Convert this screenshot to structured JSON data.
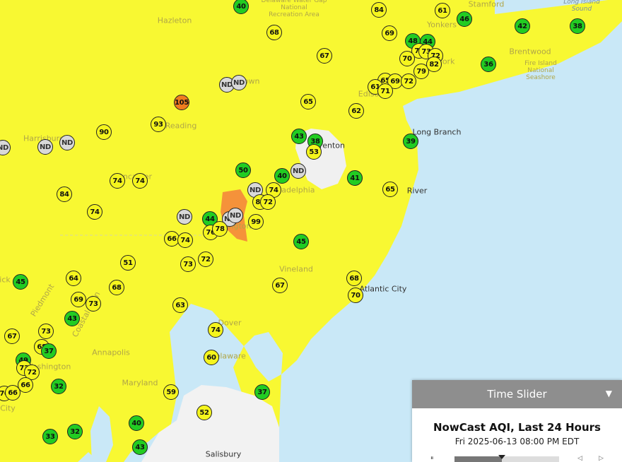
{
  "panel": {
    "header": "Time Slider",
    "toggle": "▼",
    "title": "NowCast AQI, Last 24 Hours",
    "timestamp": "Fri 2025-06-13 08:00 PM EDT",
    "progress": 0.45,
    "pause_icon": "⏸",
    "prev_icon": "◁",
    "next_icon": "▷"
  },
  "colors": {
    "good": "#22cc22",
    "moderate": "#f5f51d",
    "usg": "#f07d1e",
    "no_data": "#d9d9d9",
    "water": "#c9e8f7",
    "moderate_area": "#f8f832",
    "usg_area": "#f5923a"
  },
  "labels": [
    {
      "text": "Hazleton",
      "cls": "faded"
    },
    {
      "text": "Reading",
      "cls": "faded"
    },
    {
      "text": "town",
      "cls": "faded"
    },
    {
      "text": "Harrisburg",
      "cls": "faded"
    },
    {
      "text": "Lancaster",
      "cls": "faded"
    },
    {
      "text": "renton",
      "cls": "city"
    },
    {
      "text": "Long Branch",
      "cls": "city"
    },
    {
      "text": "Philadelphia",
      "cls": "faded"
    },
    {
      "text": "River",
      "cls": "city"
    },
    {
      "text": "ington",
      "cls": "faded"
    },
    {
      "text": "Vineland",
      "cls": "faded"
    },
    {
      "text": "Atlantic City",
      "cls": "city"
    },
    {
      "text": "Dover",
      "cls": "faded"
    },
    {
      "text": "Delaware",
      "cls": "faded"
    },
    {
      "text": "Annapolis",
      "cls": "faded"
    },
    {
      "text": "Washington",
      "cls": "faded"
    },
    {
      "text": "Maryland",
      "cls": "faded"
    },
    {
      "text": "Salisbury",
      "cls": "city"
    },
    {
      "text": "Yonkers",
      "cls": "faded"
    },
    {
      "text": "Stamford",
      "cls": "faded"
    },
    {
      "text": "York",
      "cls": "faded"
    },
    {
      "text": "Edison",
      "cls": "faded"
    },
    {
      "text": "Brentwood",
      "cls": "faded"
    },
    {
      "text": "Fire Island\nNational\nSeashore",
      "cls": "fadedsm"
    },
    {
      "text": "Delaware Water Gap\nNational\nRecreation Area",
      "cls": "fadedsm"
    },
    {
      "text": "Long Island\nSound",
      "cls": "water"
    },
    {
      "text": "ick",
      "cls": "faded"
    },
    {
      "text": "City",
      "cls": "faded"
    },
    {
      "text": "Piedmont",
      "cls": "faded"
    },
    {
      "text": "Coastal Plain",
      "cls": "faded"
    }
  ],
  "markers": [
    {
      "v": "40",
      "c": "good"
    },
    {
      "v": "84",
      "c": "moderate"
    },
    {
      "v": "61",
      "c": "moderate"
    },
    {
      "v": "46",
      "c": "good"
    },
    {
      "v": "42",
      "c": "good"
    },
    {
      "v": "38",
      "c": "good"
    },
    {
      "v": "68",
      "c": "moderate"
    },
    {
      "v": "69",
      "c": "moderate"
    },
    {
      "v": "48",
      "c": "good"
    },
    {
      "v": "44",
      "c": "good"
    },
    {
      "v": "75",
      "c": "moderate"
    },
    {
      "v": "73",
      "c": "moderate"
    },
    {
      "v": "70",
      "c": "moderate"
    },
    {
      "v": "72",
      "c": "moderate"
    },
    {
      "v": "67",
      "c": "moderate"
    },
    {
      "v": "79",
      "c": "moderate"
    },
    {
      "v": "82",
      "c": "moderate"
    },
    {
      "v": "36",
      "c": "good"
    },
    {
      "v": "ND",
      "c": "nd"
    },
    {
      "v": "ND",
      "c": "nd"
    },
    {
      "v": "65",
      "c": "moderate"
    },
    {
      "v": "69",
      "c": "moderate"
    },
    {
      "v": "72",
      "c": "moderate"
    },
    {
      "v": "61",
      "c": "moderate"
    },
    {
      "v": "71",
      "c": "moderate"
    },
    {
      "v": "105",
      "c": "usg"
    },
    {
      "v": "65",
      "c": "moderate"
    },
    {
      "v": "62",
      "c": "moderate"
    },
    {
      "v": "90",
      "c": "moderate"
    },
    {
      "v": "93",
      "c": "moderate"
    },
    {
      "v": "ND",
      "c": "nd"
    },
    {
      "v": "ND",
      "c": "nd"
    },
    {
      "v": "ND",
      "c": "nd"
    },
    {
      "v": "43",
      "c": "good"
    },
    {
      "v": "38",
      "c": "good"
    },
    {
      "v": "53",
      "c": "moderate"
    },
    {
      "v": "39",
      "c": "good"
    },
    {
      "v": "50",
      "c": "good"
    },
    {
      "v": "ND",
      "c": "nd"
    },
    {
      "v": "40",
      "c": "good"
    },
    {
      "v": "41",
      "c": "good"
    },
    {
      "v": "74",
      "c": "moderate"
    },
    {
      "v": "74",
      "c": "moderate"
    },
    {
      "v": "84",
      "c": "moderate"
    },
    {
      "v": "ND",
      "c": "nd"
    },
    {
      "v": "74",
      "c": "moderate"
    },
    {
      "v": "65",
      "c": "moderate"
    },
    {
      "v": "80",
      "c": "moderate"
    },
    {
      "v": "72",
      "c": "moderate"
    },
    {
      "v": "74",
      "c": "moderate"
    },
    {
      "v": "ND",
      "c": "nd"
    },
    {
      "v": "ND",
      "c": "nd"
    },
    {
      "v": "ND",
      "c": "nd"
    },
    {
      "v": "44",
      "c": "good"
    },
    {
      "v": "76",
      "c": "moderate"
    },
    {
      "v": "78",
      "c": "moderate"
    },
    {
      "v": "99",
      "c": "moderate"
    },
    {
      "v": "66",
      "c": "moderate"
    },
    {
      "v": "74",
      "c": "moderate"
    },
    {
      "v": "45",
      "c": "good"
    },
    {
      "v": "51",
      "c": "moderate"
    },
    {
      "v": "73",
      "c": "moderate"
    },
    {
      "v": "72",
      "c": "moderate"
    },
    {
      "v": "45",
      "c": "good"
    },
    {
      "v": "64",
      "c": "moderate"
    },
    {
      "v": "68",
      "c": "moderate"
    },
    {
      "v": "68",
      "c": "moderate"
    },
    {
      "v": "67",
      "c": "moderate"
    },
    {
      "v": "69",
      "c": "moderate"
    },
    {
      "v": "73",
      "c": "moderate"
    },
    {
      "v": "70",
      "c": "moderate"
    },
    {
      "v": "63",
      "c": "moderate"
    },
    {
      "v": "43",
      "c": "good"
    },
    {
      "v": "67",
      "c": "moderate"
    },
    {
      "v": "73",
      "c": "moderate"
    },
    {
      "v": "74",
      "c": "moderate"
    },
    {
      "v": "68",
      "c": "moderate"
    },
    {
      "v": "37",
      "c": "good"
    },
    {
      "v": "49",
      "c": "good"
    },
    {
      "v": "60",
      "c": "moderate"
    },
    {
      "v": "73",
      "c": "moderate"
    },
    {
      "v": "72",
      "c": "moderate"
    },
    {
      "v": "66",
      "c": "moderate"
    },
    {
      "v": "70",
      "c": "moderate"
    },
    {
      "v": "66",
      "c": "moderate"
    },
    {
      "v": "32",
      "c": "good"
    },
    {
      "v": "59",
      "c": "moderate"
    },
    {
      "v": "37",
      "c": "good"
    },
    {
      "v": "52",
      "c": "moderate"
    },
    {
      "v": "40",
      "c": "good"
    },
    {
      "v": "33",
      "c": "good"
    },
    {
      "v": "32",
      "c": "good"
    },
    {
      "v": "43",
      "c": "good"
    }
  ]
}
